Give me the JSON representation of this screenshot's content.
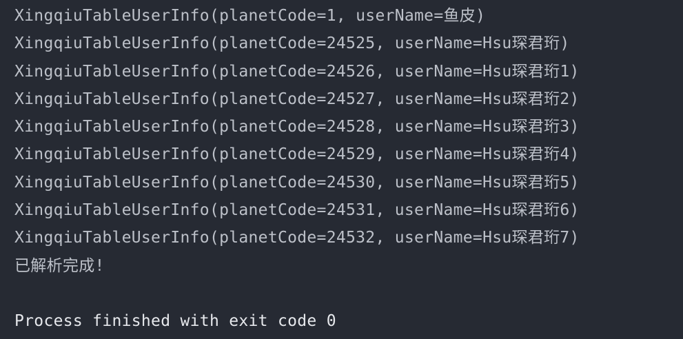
{
  "console": {
    "lines": [
      "XingqiuTableUserInfo(planetCode=1, userName=鱼皮)",
      "XingqiuTableUserInfo(planetCode=24525, userName=Hsu琛君珩)",
      "XingqiuTableUserInfo(planetCode=24526, userName=Hsu琛君珩1)",
      "XingqiuTableUserInfo(planetCode=24527, userName=Hsu琛君珩2)",
      "XingqiuTableUserInfo(planetCode=24528, userName=Hsu琛君珩3)",
      "XingqiuTableUserInfo(planetCode=24529, userName=Hsu琛君珩4)",
      "XingqiuTableUserInfo(planetCode=24530, userName=Hsu琛君珩5)",
      "XingqiuTableUserInfo(planetCode=24531, userName=Hsu琛君珩6)",
      "XingqiuTableUserInfo(planetCode=24532, userName=Hsu琛君珩7)",
      "已解析完成!"
    ],
    "exit_message": "Process finished with exit code 0"
  },
  "colors": {
    "background": "#262a33",
    "text": "#bcc0c8",
    "exit_text": "#e6e8ec"
  }
}
